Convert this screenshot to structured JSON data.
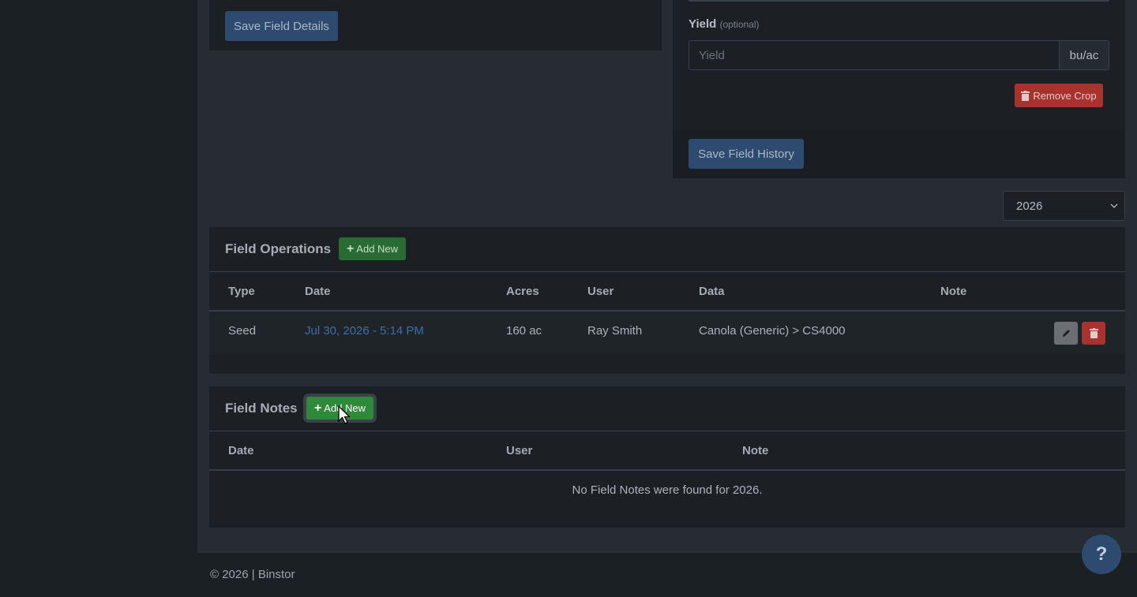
{
  "field_details": {
    "save_label": "Save Field Details"
  },
  "field_history": {
    "yield_label": "Yield",
    "yield_optional": "(optional)",
    "yield_placeholder": "Yield",
    "yield_unit": "bu/ac",
    "remove_crop_label": "Remove Crop",
    "save_label": "Save Field History"
  },
  "year_select": {
    "value": "2026"
  },
  "field_operations": {
    "title": "Field Operations",
    "add_label": "Add New",
    "columns": [
      "Type",
      "Date",
      "Acres",
      "User",
      "Data",
      "Note"
    ],
    "rows": [
      {
        "type": "Seed",
        "date": "Jul 30, 2026 - 5:14 PM",
        "acres": "160 ac",
        "user": "Ray Smith",
        "data": "Canola (Generic) > CS4000",
        "note": ""
      }
    ]
  },
  "field_notes": {
    "title": "Field Notes",
    "add_label": "Add New",
    "columns": [
      "Date",
      "User",
      "Note"
    ],
    "empty_message": "No Field Notes were found for 2026."
  },
  "footer": {
    "text": "© 2026 | Binstor"
  },
  "help": {
    "label": "?"
  },
  "colors": {
    "primary": "#2e4a6e",
    "success": "#2e8a3a",
    "danger": "#a8322d",
    "link": "#3d6ea8"
  }
}
